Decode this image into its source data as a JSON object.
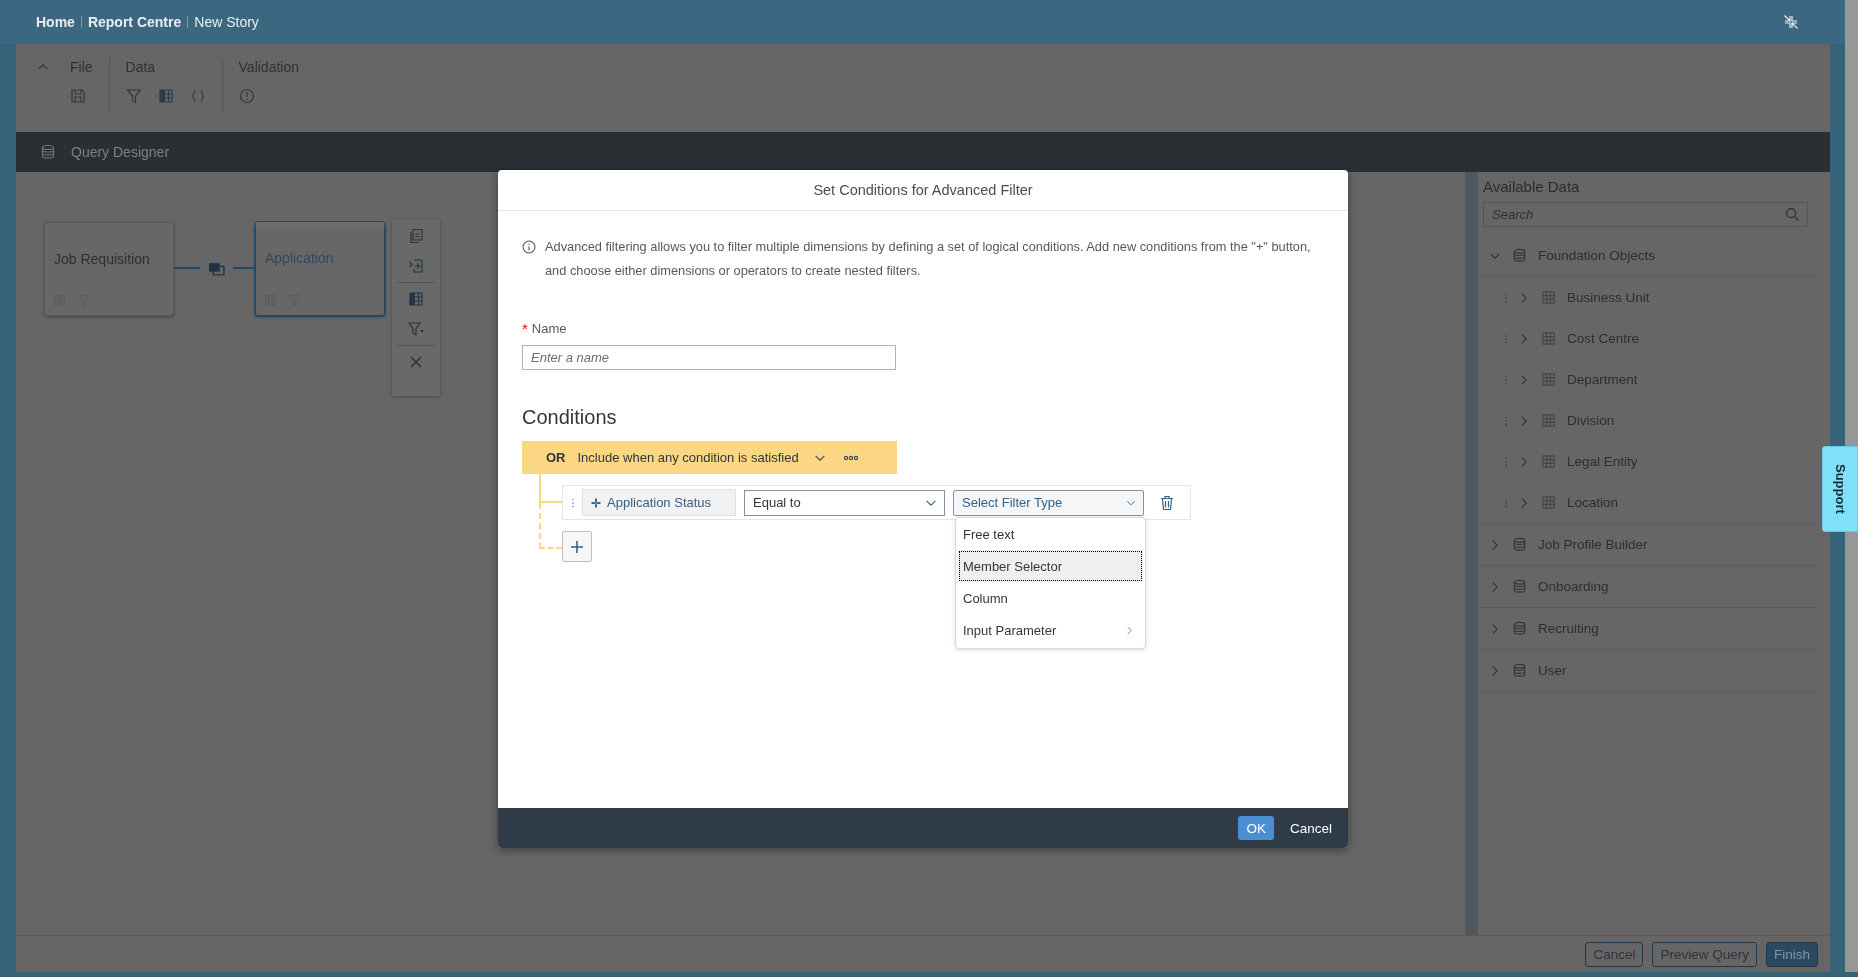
{
  "breadcrumbs": [
    {
      "label": "Home",
      "current": false
    },
    {
      "label": "Report Centre",
      "current": false
    },
    {
      "label": "New Story",
      "current": true
    }
  ],
  "toolbar": {
    "groups": [
      {
        "label": "File"
      },
      {
        "label": "Data"
      },
      {
        "label": "Validation"
      }
    ]
  },
  "query_designer": {
    "title": "Query Designer"
  },
  "canvas": {
    "nodes": [
      {
        "label": "Job Requisition",
        "selected": false
      },
      {
        "label": "Application",
        "selected": true
      }
    ]
  },
  "dialog": {
    "title": "Set Conditions for Advanced Filter",
    "info": "Advanced filtering allows you to filter multiple dimensions by defining a set of logical conditions. Add new conditions from the \"+\" button, and choose either dimensions or operators to create nested filters.",
    "name_field": {
      "required_mark": "*",
      "label": "Name",
      "placeholder": "Enter a name"
    },
    "conditions_title": "Conditions",
    "group": {
      "operator": "OR",
      "description": "Include when any condition is satisfied"
    },
    "conditions": [
      {
        "dimension": "Application Status",
        "operator": "Equal to",
        "filter_type": {
          "placeholder": "Select Filter Type",
          "open": true
        }
      }
    ],
    "filter_type_menu": [
      {
        "label": "Free text",
        "selected": false,
        "submenu": false
      },
      {
        "label": "Member Selector",
        "selected": true,
        "submenu": false
      },
      {
        "label": "Column",
        "selected": false,
        "submenu": false
      },
      {
        "label": "Input Parameter",
        "selected": false,
        "submenu": true
      }
    ],
    "buttons": [
      {
        "label": "OK",
        "kind": "primary"
      },
      {
        "label": "Cancel",
        "kind": "transparent"
      }
    ]
  },
  "available_data": {
    "title": "Available Data",
    "search": {
      "placeholder": "Search"
    },
    "tree": [
      {
        "label": "Foundation Objects",
        "expanded": true,
        "children": [
          {
            "label": "Business Unit",
            "expanded": false
          },
          {
            "label": "Cost Centre",
            "expanded": false
          },
          {
            "label": "Department",
            "expanded": false
          },
          {
            "label": "Division",
            "expanded": false
          },
          {
            "label": "Legal Entity",
            "expanded": false
          },
          {
            "label": "Location",
            "expanded": false
          }
        ]
      },
      {
        "label": "Job Profile Builder",
        "expanded": false
      },
      {
        "label": "Onboarding",
        "expanded": false
      },
      {
        "label": "Recruiting",
        "expanded": false
      },
      {
        "label": "User",
        "expanded": false
      }
    ]
  },
  "footer_buttons": [
    {
      "label": "Cancel",
      "kind": "default"
    },
    {
      "label": "Preview Query",
      "kind": "default"
    },
    {
      "label": "Finish",
      "kind": "primary"
    }
  ],
  "support_tab": {
    "label": "Support"
  }
}
